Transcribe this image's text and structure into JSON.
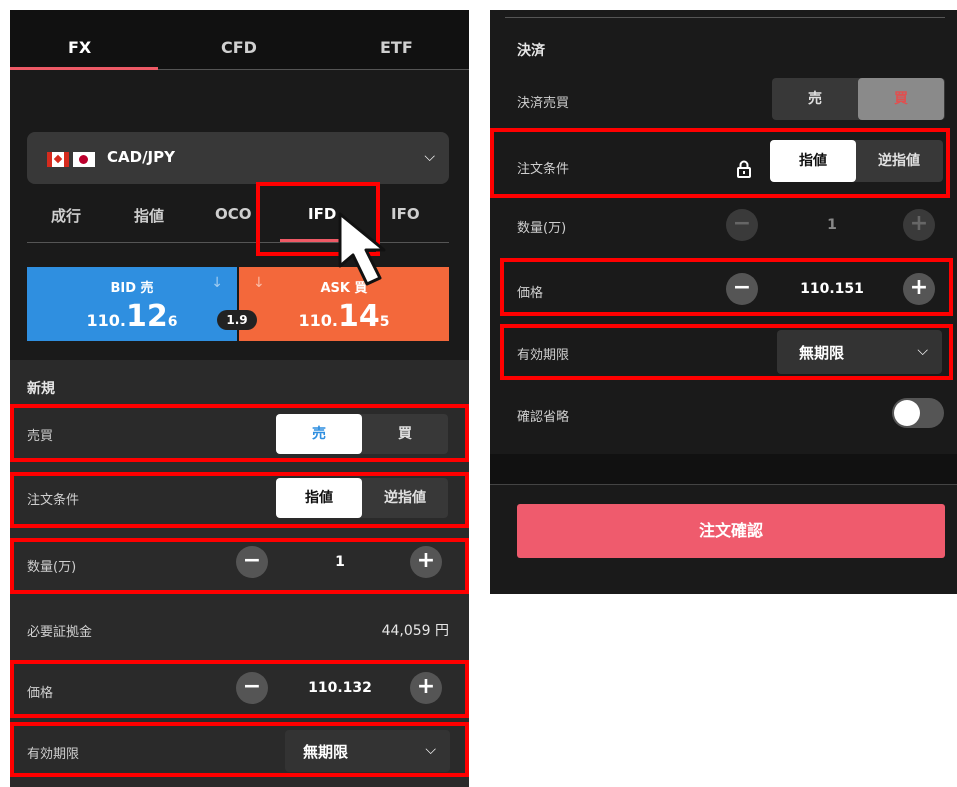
{
  "left": {
    "top_tabs": [
      {
        "label": "FX"
      },
      {
        "label": "CFD"
      },
      {
        "label": "ETF"
      }
    ],
    "pair": {
      "label": "CAD/JPY"
    },
    "order_tabs": [
      {
        "label": "成行"
      },
      {
        "label": "指値"
      },
      {
        "label": "OCO"
      },
      {
        "label": "IFD"
      },
      {
        "label": "IFO"
      }
    ],
    "bid": {
      "label": "BID 売",
      "prefix": "110.",
      "main": "12",
      "suffix": "6"
    },
    "ask": {
      "label": "ASK 買",
      "prefix": "110.",
      "main": "14",
      "suffix": "5"
    },
    "spread": "1.9",
    "section_new": "新規",
    "side": {
      "label": "売買",
      "sell": "売",
      "buy": "買"
    },
    "condition": {
      "label": "注文条件",
      "limit": "指値",
      "stop": "逆指値"
    },
    "quantity": {
      "label": "数量(万)",
      "value": "1"
    },
    "margin": {
      "label": "必要証拠金",
      "value": "44,059 円"
    },
    "price": {
      "label": "価格",
      "value": "110.132"
    },
    "expiry": {
      "label": "有効期限",
      "value": "無期限"
    }
  },
  "right": {
    "section_settle": "決済",
    "settle_side": {
      "label": "決済売買",
      "sell": "売",
      "buy": "買"
    },
    "condition": {
      "label": "注文条件",
      "limit": "指値",
      "stop": "逆指値"
    },
    "quantity": {
      "label": "数量(万)",
      "value": "1"
    },
    "price": {
      "label": "価格",
      "value": "110.151"
    },
    "expiry": {
      "label": "有効期限",
      "value": "無期限"
    },
    "skip_confirm": {
      "label": "確認省略"
    },
    "submit": "注文確認"
  },
  "colors": {
    "accent": "#ee5a66",
    "bid": "#2f8fe0",
    "ask": "#f3683b",
    "highlight": "#ff0000",
    "submit": "#ef5b6d"
  },
  "icons": [
    "canada-flag-icon",
    "japan-flag-icon",
    "chevron-down-icon",
    "minus-icon",
    "plus-icon",
    "lock-icon",
    "arrow-down-icon",
    "mouse-cursor-icon"
  ]
}
